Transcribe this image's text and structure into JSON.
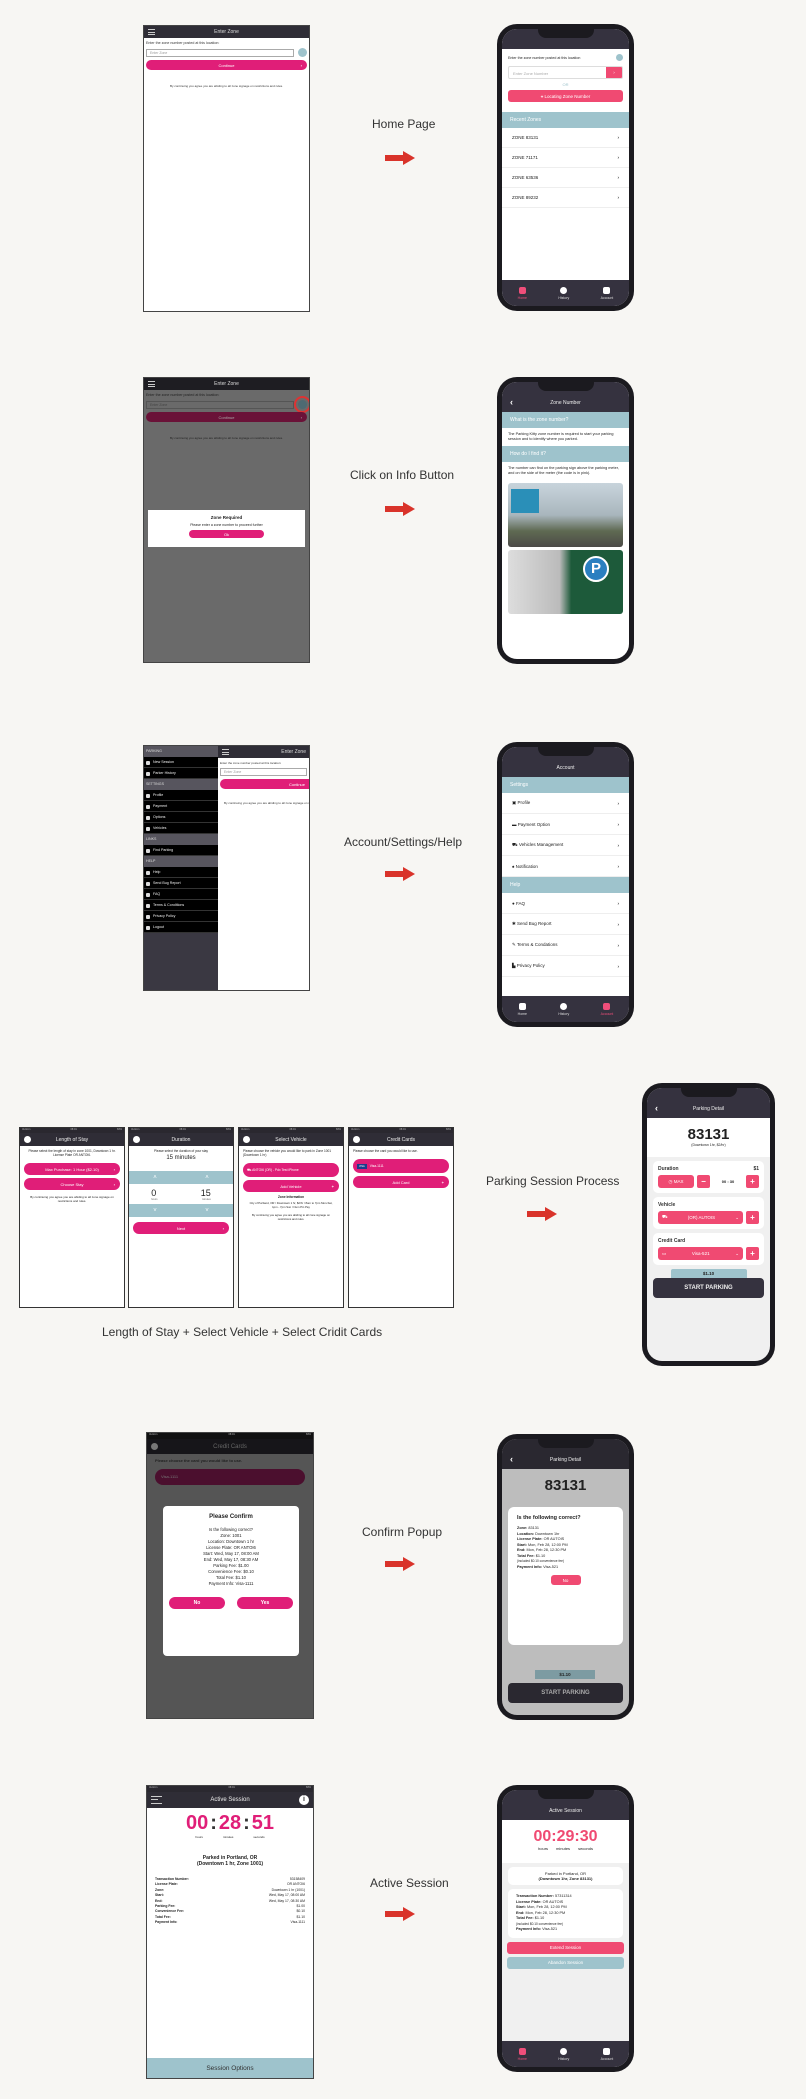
{
  "labels": {
    "home": "Home Page",
    "info": "Click on Info Button",
    "account": "Account/Settings/Help",
    "process": "Parking Session Process",
    "process_caption": "Length of Stay + Select Vehicle + Select Cridit Cards",
    "confirm": "Confirm Popup",
    "active": "Active Session"
  },
  "old_enter_zone": {
    "title": "Enter Zone",
    "prompt": "Enter the zone number posted at this location:",
    "placeholder": "Enter Zone",
    "continue": "Continue",
    "disclaimer": "By continuing you agree you are abiding to all zone signage on restrictions and rules."
  },
  "zone_required": {
    "title": "Zone Required",
    "message": "Please enter a zone number to proceed further",
    "ok": "Ok"
  },
  "new_home": {
    "prompt": "Enter the zone number posted at this location",
    "placeholder": "Enter Zone Number",
    "or": "OR",
    "locate": "Locating Zone Number",
    "recent_header": "Recent Zones",
    "recent": [
      "ZONE 83131",
      "ZONE 71171",
      "ZONE 63536",
      "ZONE 89232"
    ]
  },
  "tabs": [
    "Home",
    "History",
    "Account"
  ],
  "zone_info": {
    "title": "Zone Number",
    "q1": "What is the zone number?",
    "a1": "The Parking Kitty zone number is required to start your parking session and to identify where you parked.",
    "q2": "How do I find it?",
    "a2": "The number can find on the parking sign above the parking meter, and on the side of the meter (the code is in pink)."
  },
  "drawer": {
    "header": "Enter Zone",
    "sections": [
      {
        "title": "PARKING",
        "items": [
          "New Session",
          "Parker History"
        ]
      },
      {
        "title": "SETTINGS",
        "items": [
          "Profile",
          "Payment",
          "Options",
          "Vehicles"
        ]
      },
      {
        "title": "LINKS",
        "items": [
          "Find Parking"
        ]
      },
      {
        "title": "HELP",
        "items": [
          "Help",
          "Send Bug Report",
          "FAQ",
          "Terms & Conditions",
          "Privacy Policy",
          "Logout"
        ]
      }
    ]
  },
  "account": {
    "title": "Account",
    "settings": "Settings",
    "settings_items": [
      "Profile",
      "Payment Option",
      "Vehicles Management",
      "Notification"
    ],
    "help": "Help",
    "help_items": [
      "FAQ",
      "Send Bug Report",
      "Terms & Condations",
      "Privacy Policy"
    ]
  },
  "status": {
    "carrier": "Verizon",
    "time": "08:01",
    "battery": "83%"
  },
  "length_of_stay": {
    "title": "Length of Stay",
    "text": "Please select the length of stay in zone 1001, Downtown 1 hr. License Plate OR ANTOI6.",
    "max": "Max Purchase: 1 Hour ($2.10)",
    "choose": "Choose Stay",
    "disclaimer": "By continuing you agree you are abiding to all zone signage on restrictions and rules."
  },
  "duration": {
    "title": "Duration",
    "text": "Please select the duration of your stay",
    "value": "15 minutes",
    "hours": "0",
    "minutes": "15",
    "hours_label": "hours",
    "minutes_label": "minutes",
    "next": "Next"
  },
  "select_vehicle": {
    "title": "Select Vehicle",
    "text": "Please choose the vehicle you would like to park in Zone 1001 (Downtown 1 hr)",
    "vehicle": "ANTOI6 (OR) - Pdx Test iPhone",
    "add": "Add Vehicle",
    "zone_info_title": "Zone Information",
    "zone_info": "City of Portland, OR / Downtown 1 hr, $2/hr / 8am to 7pm Mon-Sat, 1pm - 7pm Sun / Num Pin Pay",
    "disclaimer": "By continuing you agree you are abiding to all zone signage on restrictions and rules."
  },
  "credit_cards": {
    "title": "Credit Cards",
    "text": "Please choose the card you would like to use.",
    "card_brand": "VISA",
    "card": "Visa-1111",
    "add": "Add Card"
  },
  "parking_detail": {
    "title": "Parking Detail",
    "zone": "83131",
    "zone_sub": "(Downtown 1hr, $2/hr)",
    "duration_label": "Duration",
    "price": "$1",
    "max": "MAX",
    "time": "00 : 30",
    "vehicle_label": "Vehicle",
    "vehicle": "(OR) AUTOIS",
    "card_label": "Credit Card",
    "card": "Visa-521",
    "total": "$1.10",
    "start": "START PARKING"
  },
  "old_confirm": {
    "title": "Please Confirm",
    "question": "Is the following correct?",
    "lines": [
      "Zone: 1001",
      "Location: Downtown 1 hr",
      "License Plate: OR ANTOI6",
      "Start: Wed, May 17, 08:00 AM",
      "End: Wed, May 17, 08:30 AM",
      "Parking Fee: $1.00",
      "Convenience Fee: $0.10",
      "Total Fee: $1.10",
      "Payment Info: Visa-1111"
    ],
    "no": "No",
    "yes": "Yes"
  },
  "new_confirm": {
    "question": "Is the following correct?",
    "rows": [
      [
        "Zone:",
        "83131"
      ],
      [
        "Location:",
        "Downtown 1hr"
      ],
      [
        "License Plate:",
        "OR AUTOIS"
      ],
      [
        "Start:",
        "Mon, Feb 28, 12:00 PM"
      ],
      [
        "End:",
        "Mon, Feb 28, 12:30 PM"
      ],
      [
        "Total Fee:",
        "$1.10"
      ],
      [
        "Payment Info:",
        "Visa-521"
      ]
    ],
    "fee_note": "(included $0.10 convenience fee)",
    "no": "No"
  },
  "old_active": {
    "title": "Active Session",
    "h": "00",
    "m": "28",
    "s": "51",
    "hl": "hours",
    "ml": "minutes",
    "sl": "seconds",
    "parked": "Parked in Portland, OR",
    "parked_sub": "(Downtown 1 hr, Zone 1001)",
    "rows": [
      [
        "Transaction Number:",
        "53158409"
      ],
      [
        "License Plate:",
        "OR ANTOI6"
      ],
      [
        "Zone:",
        "Downtown 1 hr (1001)"
      ],
      [
        "Start:",
        "Wed, May 17, 08:00 AM"
      ],
      [
        "End:",
        "Wed, May 17, 08:30 AM"
      ],
      [
        "Parking Fee:",
        "$1.00"
      ],
      [
        "Convenience Fee:",
        "$0.10"
      ],
      [
        "Total Fee:",
        "$1.10"
      ],
      [
        "Payment Info:",
        "Visa-1111"
      ]
    ],
    "options": "Session Options"
  },
  "new_active": {
    "title": "Active Session",
    "time": "00:29:30",
    "hl": "hours",
    "ml": "minutes",
    "sl": "seconds",
    "parked": "Parked in Portland, OR",
    "parked_sub": "(Downtown 1hr, Zone 83131)",
    "rows": [
      [
        "Transaction Number:",
        "57311314"
      ],
      [
        "License Plate:",
        "OR AUTOIS"
      ],
      [
        "Start:",
        "Mon, Feb 28, 12:00 PM"
      ],
      [
        "End:",
        "Mon, Feb 28, 12:30 PM"
      ],
      [
        "Total Fee:",
        "$1.10"
      ],
      [
        "Payment Info:",
        "Visa-521"
      ]
    ],
    "fee_note": "(included $0.10 convenience fee)",
    "extend": "Extend Session",
    "abandon": "Abandon Session"
  },
  "colors": {
    "pink_old": "#e01e78",
    "pink_new": "#f04a72",
    "teal": "#9ec3cc",
    "header": "#35323f",
    "arrow": "#d9332a"
  }
}
